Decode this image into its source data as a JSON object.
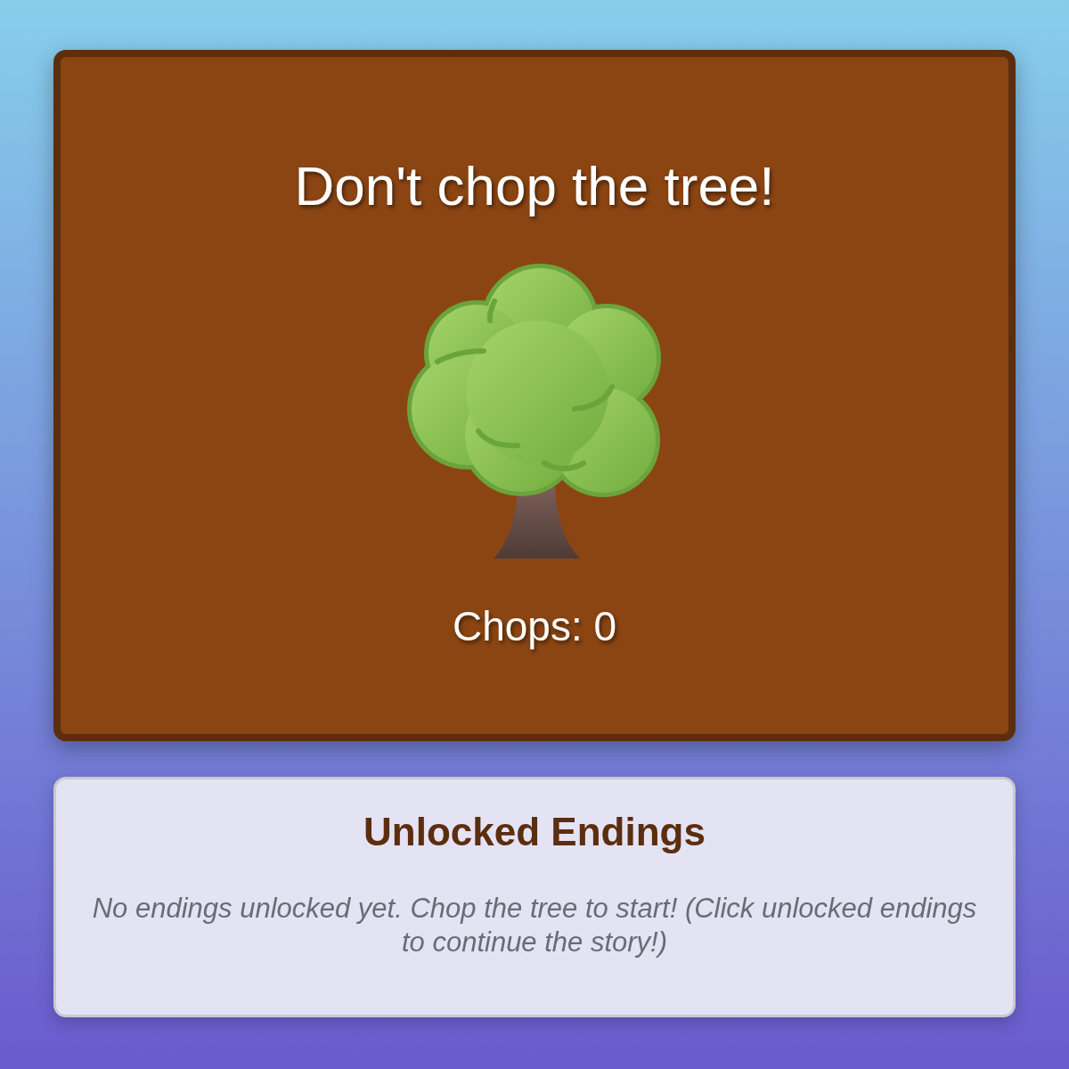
{
  "game": {
    "title": "Don't chop the tree!",
    "counter": "Chops: 0"
  },
  "endings": {
    "title": "Unlocked Endings",
    "empty_message": "No endings unlocked yet. Chop the tree to start! (Click unlocked endings to continue the story!)"
  }
}
